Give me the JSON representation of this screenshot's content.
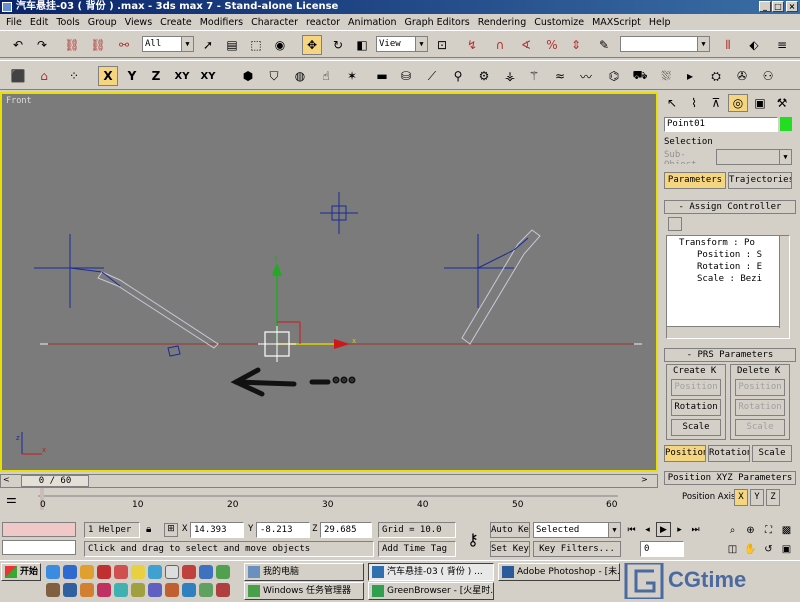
{
  "window": {
    "title": "汽车悬挂-03 ( 背份 ) .max - 3ds max 7 - Stand-alone License",
    "controls": [
      "_",
      "□",
      "×"
    ]
  },
  "menu": [
    "File",
    "Edit",
    "Tools",
    "Group",
    "Views",
    "Create",
    "Modifiers",
    "Character",
    "reactor",
    "Animation",
    "Graph Editors",
    "Rendering",
    "Customize",
    "MAXScript",
    "Help"
  ],
  "toolbar": {
    "selection_filter": "All",
    "ref_coord": "View",
    "axis_buttons": [
      "X",
      "Y",
      "Z",
      "XY",
      "XY"
    ]
  },
  "viewport": {
    "label": "Front"
  },
  "command_panel": {
    "object_name": "Point01",
    "object_color": "#22dd22",
    "selection_label": "Selection",
    "sub_object": "Sub-Object",
    "tabs": [
      "Parameters",
      "Trajectories"
    ],
    "assign_controller_title": "Assign Controller",
    "tree": [
      "Transform : Po",
      "Position : S",
      "Rotation : E",
      "Scale : Bezi"
    ],
    "prs_title": "PRS Parameters",
    "create_key": "Create K",
    "delete_key": "Delete K",
    "create_buttons": [
      "Position",
      "Rotation",
      "Scale"
    ],
    "delete_buttons": [
      "Position",
      "Rotation",
      "Scale"
    ],
    "mode_buttons": [
      "Position",
      "Rotation",
      "Scale"
    ],
    "xyz_title": "Position XYZ Parameters",
    "position_axis_label": "Position Axis:",
    "axes": [
      "X",
      "Y",
      "Z"
    ]
  },
  "timeline": {
    "slider": "0 / 60",
    "ticks": [
      "0",
      "10",
      "20",
      "30",
      "40",
      "50",
      "60"
    ]
  },
  "status": {
    "selection_count": "1 Helper",
    "x": "14.393",
    "y": "-8.213",
    "z": "29.685",
    "grid": "Grid = 10.0",
    "prompt": "Click and drag to select and move objects",
    "add_time_tag": "Add Time Tag",
    "auto_key": "Auto Key",
    "set_key": "Set Key",
    "key_filter": "Selected",
    "key_filters": "Key Filters...",
    "frame": "0"
  },
  "taskbar": {
    "start": "开始",
    "tasks": [
      "我的电脑",
      "汽车悬挂-03 ( 背份 ) ...",
      "Adobe Photoshop - [未...",
      "Windows 任务管理器",
      "GreenBrowser - [火星时..."
    ]
  },
  "watermark": "CGtime"
}
